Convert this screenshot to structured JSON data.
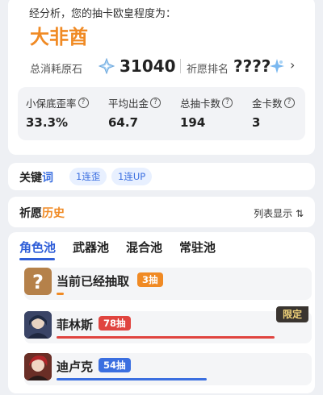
{
  "summary": {
    "caption": "经分析，您的抽卡欧皇程度为：",
    "rank_title": "大非酋",
    "total_label": "总消耗原石",
    "total_value": "31040",
    "rank_label": "祈愿排名",
    "rank_value": "????",
    "icons": {
      "stone": "primogem-icon",
      "rank": "star-icon",
      "chevron": "chevron-right-icon"
    }
  },
  "stats": [
    {
      "label": "小保底歪率",
      "value": "33.3%"
    },
    {
      "label": "平均出金",
      "value": "64.7"
    },
    {
      "label": "总抽卡数",
      "value": "194"
    },
    {
      "label": "金卡数",
      "value": "3"
    }
  ],
  "keywords": {
    "title_main": "关键",
    "title_accent": "词",
    "tags": [
      "1连歪",
      "1连UP"
    ]
  },
  "history": {
    "title_main": "祈愿",
    "title_accent": "历史",
    "toggle_label": "列表显示 ⇅"
  },
  "pool": {
    "tabs": [
      "角色池",
      "武器池",
      "混合池",
      "常驻池"
    ],
    "active_tab": 0,
    "entries": [
      {
        "name": "当前已经抽取",
        "count": "3抽",
        "badge_color": "#f08a24",
        "bar_color": "#f08a24",
        "progress": 0.03,
        "limited": false
      },
      {
        "name": "菲林斯",
        "count": "78抽",
        "badge_color": "#e0443f",
        "bar_color": "#e0443f",
        "progress": 0.87,
        "limited": true,
        "limited_label": "限定"
      },
      {
        "name": "迪卢克",
        "count": "54抽",
        "badge_color": "#3b6fe0",
        "bar_color": "#3b6fe0",
        "progress": 0.6,
        "limited": false
      }
    ]
  },
  "colors": {
    "accent_orange": "#f08a24",
    "accent_blue": "#2f5ed8",
    "accent_red": "#e0443f"
  }
}
